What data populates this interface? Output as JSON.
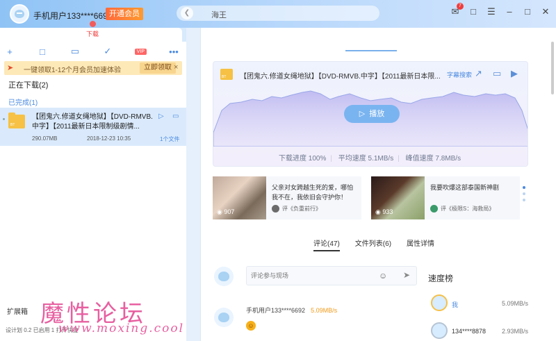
{
  "titlebar": {
    "username": "手机用户133****6692",
    "vip_label": "开通会员",
    "search_text": "海王",
    "search_back_icon": "arrow-left-icon",
    "message_badge": "7"
  },
  "left": {
    "tab_label": "下载",
    "promo_text": "一键领取1-12个月会员加速体验",
    "promo_button": "立即领取",
    "promo_close": "×",
    "tool_vip": "VIP",
    "section_downloading": "正在下载(2)",
    "section_done": "已完成(1)",
    "item": {
      "folder_tag": "BT",
      "name": "【团鬼六.修道女绳地狱】【DVD-RMVB.中字】【2011最新日本限制级剧情...",
      "size": "290.07MB",
      "date": "2018-12-23 10:35",
      "files": "1个文件"
    },
    "plugin_label": "扩展箱",
    "status_text": "设计划 0.2 已启用 1 打开快捷"
  },
  "watermark": {
    "text": "魔性论坛",
    "url": "www.moxing.cool"
  },
  "detail": {
    "folder_tag": "BT",
    "title": "【团鬼六.修道女绳地狱】【DVD-RMVB.中字】【2011最新日本限...",
    "subtitle_search": "字幕搜索",
    "play_button": "播放",
    "progress": "下载进度 100%",
    "avg_speed": "平均速度 5.1MB/s",
    "peak_speed": "峰值速度 7.8MB/s"
  },
  "videos": [
    {
      "views": "907",
      "title": "父亲对女跨越生死的爱，哪怕我不在，我依旧会守护你！",
      "source": "评《负重前行》"
    },
    {
      "views": "933",
      "title": "我要吹爆这部泰国新神剧",
      "source": "评《极限S：海救局》"
    }
  ],
  "tabs": [
    {
      "label": "评论(47)"
    },
    {
      "label": "文件列表(6)"
    },
    {
      "label": "属性详情"
    }
  ],
  "comment": {
    "placeholder": "评论参与现场",
    "user": "手机用户133****6692",
    "speed": "5.09MB/s"
  },
  "rank": {
    "title": "速度榜",
    "items": [
      {
        "name": "我",
        "speed": "5.09MB/s"
      },
      {
        "name": "134****8878",
        "speed": "2.93MB/s"
      }
    ]
  },
  "colors": {
    "accent": "#4a8ae0",
    "vip": "#ff7a34",
    "selected_row": "#daeafc"
  }
}
